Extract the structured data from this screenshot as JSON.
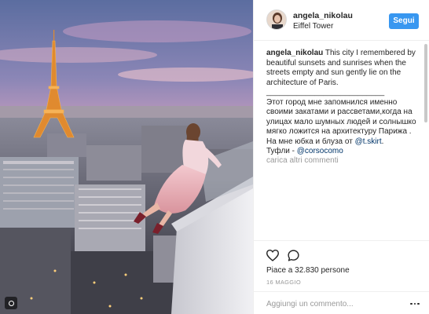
{
  "post": {
    "username": "angela_nikolau",
    "location": "Eiffel Tower",
    "follow_label": "Segui",
    "caption_user": "angela_nikolau",
    "caption_en": " This city I remembered by beautiful sunsets and sunrises when the streets empty and sun gently lie on the architecture of Paris.",
    "separator": "___________________________",
    "caption_ru_1": "Этот город мне запомнился именно своими закатами и рассветами,когда на улицах мало шумных людей и солнышко мягко ложится на архитектуру Парижа .",
    "caption_ru_2_prefix": "На мне юбка и блуза от ",
    "caption_ru_2_link": "@t.skirt",
    "caption_ru_2_suffix": ".",
    "caption_ru_3_prefix": "Туфли - ",
    "caption_ru_3_link": "@corsocomo",
    "load_more": "carica altri commenti",
    "likes": "Piace a 32.830 persone",
    "date": "16 MAGGIO",
    "comment_placeholder": "Aggiungi un commento...",
    "accent_color": "#3897f0"
  },
  "icons": {
    "like": "heart-icon",
    "comment": "comment-bubble-icon",
    "more": "ellipsis-icon",
    "photo_badge": "user-tag-icon"
  }
}
